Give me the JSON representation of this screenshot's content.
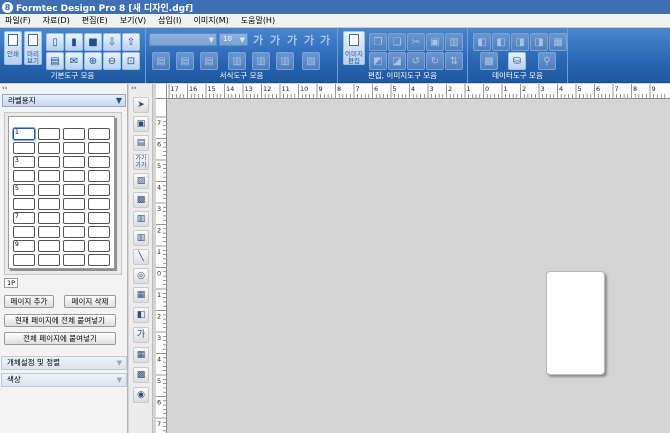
{
  "window": {
    "title": "Formtec Design Pro 8 [새 디자인.dgf]"
  },
  "menu": {
    "items": [
      "파일(F)",
      "자료(D)",
      "편집(E)",
      "보기(V)",
      "삽입(I)",
      "이미지(M)",
      "도움말(H)"
    ]
  },
  "ribbon": {
    "print_label": "인쇄",
    "preview_label_1": "미리",
    "preview_label_2": "보기",
    "font_name_value": "",
    "font_size_value": "10",
    "font_style_glyphs": [
      "가",
      "가",
      "가",
      "가",
      "가"
    ],
    "image_edit_label_1": "이미지",
    "image_edit_label_2": "편집",
    "groups": {
      "basic": "기본도구 모음",
      "format": "서식도구 모음",
      "edit_image": "편집, 이미지도구 모음",
      "data": "데이터도구 모음"
    }
  },
  "left_panel": {
    "header": "››",
    "label_type": "라벨용지",
    "sheet_row_numbers": [
      "1",
      "3",
      "5",
      "7",
      "9"
    ],
    "page_tab": "1P",
    "buttons": {
      "add_page": "페이지 추가",
      "delete_page": "페이지 삭제",
      "paste_all_current": "현재 페이지에 전체 붙여넣기",
      "paste_all_pages": "전체 페이지에 붙여넣기"
    },
    "sections": {
      "object_settings": "개체설정 및 정렬",
      "color": "색상"
    }
  },
  "toolstrip": {
    "header": "››",
    "tools": [
      "select-tool",
      "image-tool",
      "form-tool",
      "text-tool",
      "picture-tool",
      "qr-tool",
      "barcode-tool",
      "barcode2-tool",
      "line-tool",
      "shape-tool",
      "grid-tool",
      "gradient-tool",
      "vertical-text-tool",
      "table-tool",
      "clipart-tool",
      "stamp-tool"
    ]
  },
  "rulers": {
    "top_ticks": [
      "17",
      "16",
      "15",
      "14",
      "13",
      "12",
      "11",
      "10",
      "9",
      "8",
      "7",
      "6",
      "5",
      "4",
      "3",
      "2",
      "1",
      "0",
      "1",
      "2",
      "3",
      "4",
      "5",
      "6",
      "7",
      "8",
      "9"
    ],
    "left_ticks": [
      "7",
      "6",
      "5",
      "4",
      "3",
      "2",
      "1",
      "0",
      "1",
      "2",
      "3",
      "4",
      "5",
      "6",
      "7"
    ]
  }
}
